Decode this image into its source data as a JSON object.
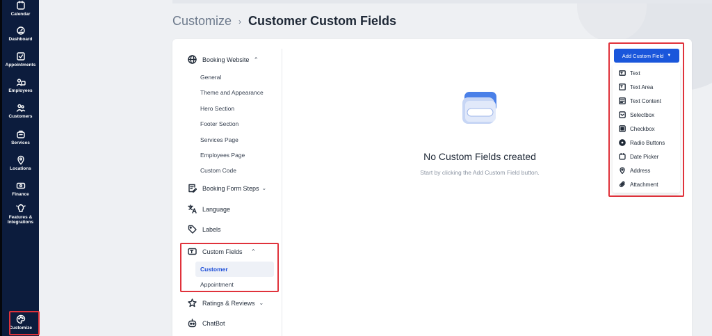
{
  "sidebar": {
    "items": [
      {
        "label": "Calendar",
        "icon": "calendar-icon"
      },
      {
        "label": "Dashboard",
        "icon": "dashboard-icon"
      },
      {
        "label": "Appointments",
        "icon": "appointments-icon"
      },
      {
        "label": "Employees",
        "icon": "employees-icon"
      },
      {
        "label": "Customers",
        "icon": "customers-icon"
      },
      {
        "label": "Services",
        "icon": "services-icon"
      },
      {
        "label": "Locations",
        "icon": "location-pin-icon"
      },
      {
        "label": "Finance",
        "icon": "finance-icon"
      },
      {
        "label": "Features &",
        "label2": "Integrations",
        "icon": "features-icon"
      },
      {
        "label": "Customize",
        "icon": "palette-icon"
      }
    ]
  },
  "header": {
    "parent": "Customize",
    "separator": "›",
    "title": "Customer Custom Fields"
  },
  "menu": {
    "booking_website": {
      "label": "Booking Website",
      "chevron": "^",
      "subitems": [
        "General",
        "Theme and Appearance",
        "Hero Section",
        "Footer Section",
        "Services Page",
        "Employees Page",
        "Custom Code"
      ]
    },
    "booking_form_steps": {
      "label": "Booking Form Steps",
      "chevron": "⌄"
    },
    "language": {
      "label": "Language"
    },
    "labels": {
      "label": "Labels"
    },
    "custom_fields": {
      "label": "Custom Fields",
      "chevron": "^",
      "subitems": [
        "Customer",
        "Appointment"
      ]
    },
    "ratings_reviews": {
      "label": "Ratings & Reviews",
      "chevron": "⌄"
    },
    "chatbot": {
      "label": "ChatBot"
    }
  },
  "empty_state": {
    "title": "No Custom Fields created",
    "subtitle": "Start by clicking the Add Custom Field button."
  },
  "add_field": {
    "button_label": "Add Custom Field",
    "caret": "▼",
    "options": [
      {
        "label": "Text",
        "icon": "text-field-icon"
      },
      {
        "label": "Text Area",
        "icon": "text-area-icon"
      },
      {
        "label": "Text Content",
        "icon": "text-content-icon"
      },
      {
        "label": "Selectbox",
        "icon": "selectbox-icon"
      },
      {
        "label": "Checkbox",
        "icon": "checkbox-icon"
      },
      {
        "label": "Radio Buttons",
        "icon": "radio-icon"
      },
      {
        "label": "Date Picker",
        "icon": "date-picker-icon"
      },
      {
        "label": "Address",
        "icon": "address-pin-icon"
      },
      {
        "label": "Attachment",
        "icon": "attachment-icon"
      }
    ]
  },
  "colors": {
    "sidebar_bg": "#0c1c3d",
    "accent_blue": "#1a56db",
    "highlight_red": "#e0323b"
  }
}
